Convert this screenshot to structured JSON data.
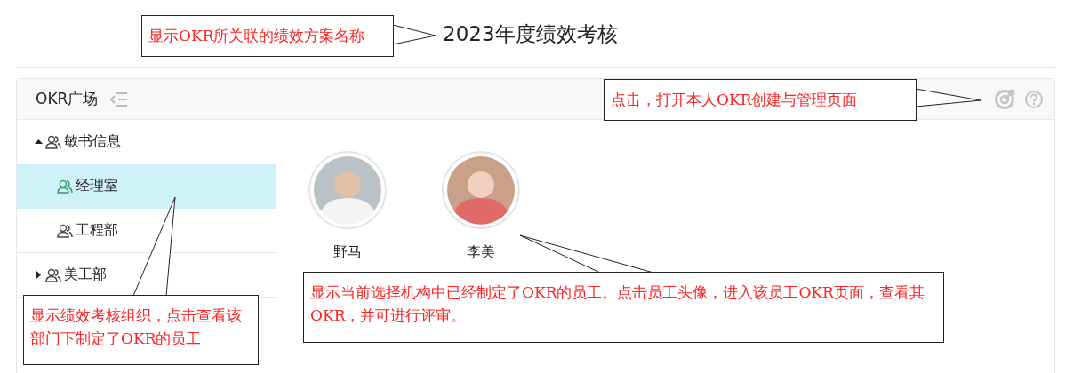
{
  "title": "2023年度绩效考核",
  "panel": {
    "title": "OKR广场"
  },
  "tree": [
    {
      "label": "敏书信息",
      "expanded": true,
      "selected": false,
      "children": [
        {
          "label": "经理室",
          "selected": true
        },
        {
          "label": "工程部",
          "selected": false
        }
      ]
    },
    {
      "label": "美工部",
      "expanded": false,
      "selected": false
    }
  ],
  "employees": [
    {
      "name": "野马"
    },
    {
      "name": "李美"
    }
  ],
  "callouts": [
    {
      "text": "显示OKR所关联的绩效方案名称"
    },
    {
      "text": "点击，打开本人OKR创建与管理页面"
    },
    {
      "text": "显示绩效考核组织，点击查看该部门下制定了OKR的员工"
    },
    {
      "text": "显示当前选择机构中已经制定了OKR的员工。点击员工头像，进入该员工OKR页面，查看其OKR，并可进行评审。"
    }
  ]
}
